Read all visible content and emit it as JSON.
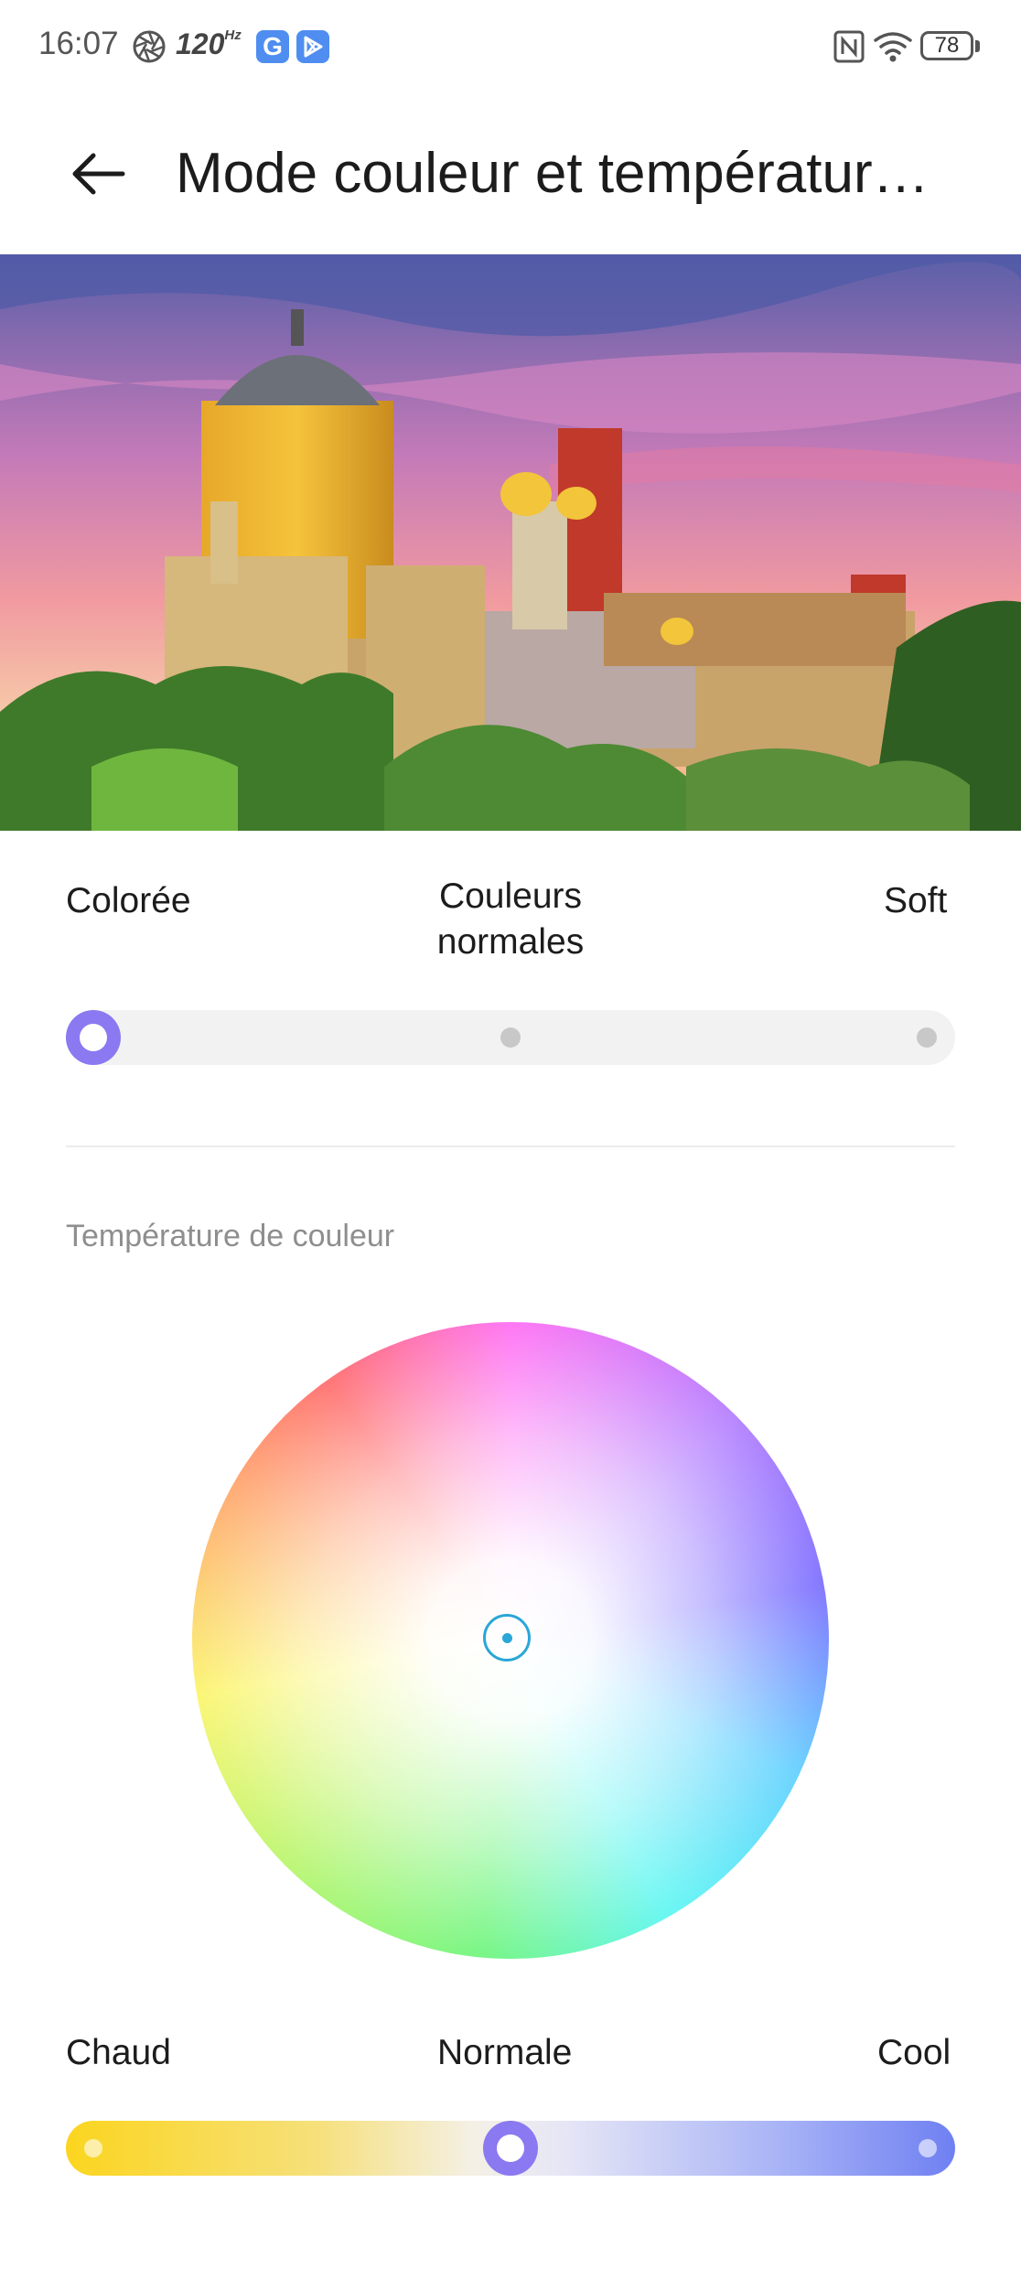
{
  "status_bar": {
    "time": "16:07",
    "refresh_rate": "120",
    "refresh_unit": "Hz",
    "google_badge": "G",
    "battery": "78"
  },
  "header": {
    "title": "Mode couleur et températur…"
  },
  "color_mode": {
    "options": [
      "Colorée",
      "Couleurs normales",
      "Soft"
    ],
    "selected": "Colorée"
  },
  "color_temperature": {
    "section_label": "Température de couleur",
    "options": [
      "Chaud",
      "Normale",
      "Cool"
    ],
    "selected": "Normale"
  },
  "colors": {
    "accent": "#8a79f0",
    "picker": "#2aa6d8",
    "warm": "#fbd51f",
    "cool": "#6f80f2"
  }
}
